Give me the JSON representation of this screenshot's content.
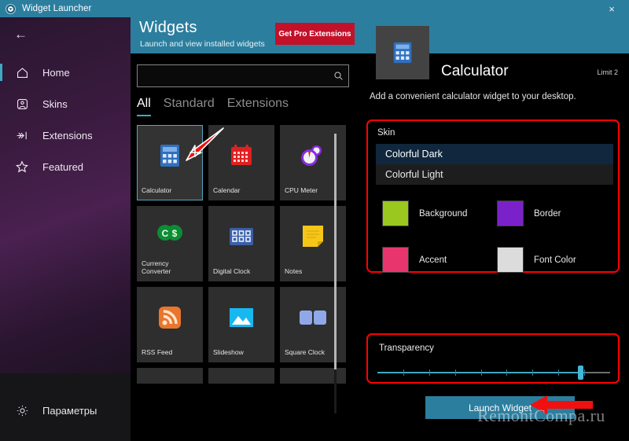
{
  "window": {
    "title": "Widget Launcher",
    "icon": "widget-launcher-icon",
    "close_label": "×",
    "titlebar_color": "#2c7e9e"
  },
  "sidebar": {
    "back_label": "←",
    "items": [
      {
        "label": "Home",
        "icon": "home-icon",
        "active": true
      },
      {
        "label": "Skins",
        "icon": "skins-icon",
        "active": false
      },
      {
        "label": "Extensions",
        "icon": "extensions-icon",
        "active": false
      },
      {
        "label": "Featured",
        "icon": "star-icon",
        "active": false
      }
    ],
    "settings": {
      "label": "Параметры",
      "icon": "gear-icon"
    }
  },
  "header": {
    "title": "Widgets",
    "subtitle": "Launch and view installed widgets",
    "pro_button": "Get Pro Extensions",
    "pro_color": "#c3112a"
  },
  "search": {
    "value": "",
    "placeholder": "",
    "icon": "search-icon"
  },
  "tabs": [
    {
      "label": "All",
      "active": true
    },
    {
      "label": "Standard",
      "active": false
    },
    {
      "label": "Extensions",
      "active": false
    }
  ],
  "widgets": [
    {
      "label": "Calculator",
      "icon": "calculator-icon",
      "selected": true
    },
    {
      "label": "Calendar",
      "icon": "calendar-icon",
      "selected": false
    },
    {
      "label": "CPU Meter",
      "icon": "cpu-meter-icon",
      "selected": false
    },
    {
      "label": "Currency Converter",
      "icon": "currency-converter-icon",
      "selected": false
    },
    {
      "label": "Digital Clock",
      "icon": "digital-clock-icon",
      "selected": false
    },
    {
      "label": "Notes",
      "icon": "notes-icon",
      "selected": false
    },
    {
      "label": "RSS Feed",
      "icon": "rss-feed-icon",
      "selected": false
    },
    {
      "label": "Slideshow",
      "icon": "slideshow-icon",
      "selected": false
    },
    {
      "label": "Square Clock",
      "icon": "square-clock-icon",
      "selected": false
    }
  ],
  "detail": {
    "title": "Calculator",
    "limit": "Limit 2",
    "description": "Add a convenient calculator widget to your desktop.",
    "icon": "calculator-icon",
    "skin": {
      "label": "Skin",
      "options": [
        {
          "label": "Colorful Dark",
          "selected": true
        },
        {
          "label": "Colorful Light",
          "selected": false
        }
      ],
      "swatches": [
        {
          "name": "Background",
          "color": "#9ac81e"
        },
        {
          "name": "Border",
          "color": "#7b21c9"
        },
        {
          "name": "Accent",
          "color": "#e8356d"
        },
        {
          "name": "Font Color",
          "color": "#dcdcdc"
        }
      ]
    },
    "transparency": {
      "label": "Transparency",
      "value": 87,
      "min": 0,
      "max": 100,
      "fill_color": "#3fa8c4"
    },
    "launch_button": "Launch Widget"
  },
  "annotations": {
    "arrow_to_calculator_tile": "red-arrow-icon",
    "arrow_to_launch_button": "red-arrow-icon",
    "watermark": "RemontCompa.ru"
  }
}
